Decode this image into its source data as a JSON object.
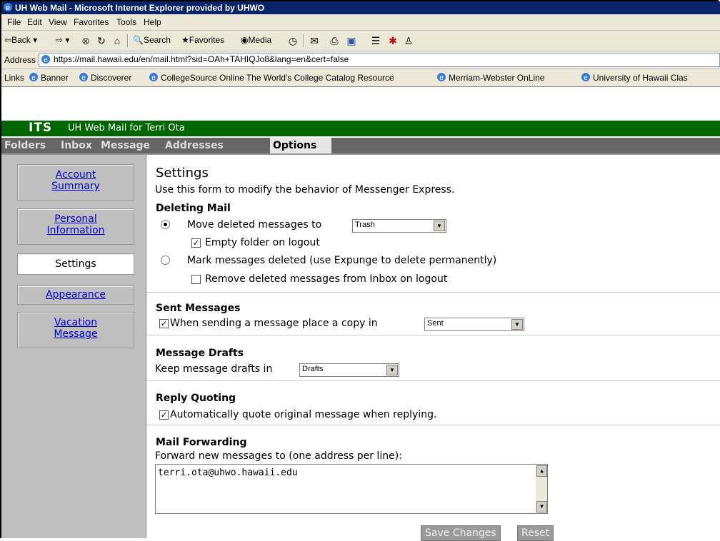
{
  "window": {
    "title": "UH Web Mail - Microsoft Internet Explorer provided by UHWO"
  },
  "menu": [
    "File",
    "Edit",
    "View",
    "Favorites",
    "Tools",
    "Help"
  ],
  "toolbar": {
    "back": "Back",
    "search": "Search",
    "favorites": "Favorites",
    "media": "Media"
  },
  "address": {
    "label": "Address",
    "url": "https://mail.hawaii.edu/en/mail.html?sid=OAh+TAHIQJo8&lang=en&cert=false"
  },
  "links": {
    "label": "Links",
    "items": [
      "Banner",
      "Discoverer",
      "CollegeSource Online  The World's College Catalog Resource",
      "Merriam-Webster OnLine",
      "University of Hawaii Clas"
    ]
  },
  "app": {
    "logo": "ITS",
    "subtitle": "UH Web Mail for Terri Ota"
  },
  "tabs": [
    "Folders",
    "Inbox",
    "Message",
    "Addresses",
    "Options"
  ],
  "sidebar": {
    "account": [
      "Account",
      "Summary"
    ],
    "personal": [
      "Personal",
      "Information"
    ],
    "settings": "Settings",
    "appearance": "Appearance",
    "vacation": [
      "Vacation",
      "Message"
    ]
  },
  "settings": {
    "title": "Settings",
    "intro": "Use this form to modify the behavior of Messenger Express.",
    "deleting": {
      "heading": "Deleting Mail",
      "move_label": "Move deleted messages to",
      "move_folder": "Trash",
      "empty_label": "Empty folder on logout",
      "mark_label": "Mark messages deleted (use Expunge to delete permanently)",
      "remove_label": "Remove deleted messages from Inbox on logout"
    },
    "sent": {
      "heading": "Sent Messages",
      "label": "When sending a message place a copy in",
      "folder": "Sent"
    },
    "drafts": {
      "heading": "Message Drafts",
      "label": "Keep message drafts in",
      "folder": "Drafts"
    },
    "reply": {
      "heading": "Reply Quoting",
      "label": "Automatically quote original message when replying."
    },
    "forwarding": {
      "heading": "Mail Forwarding",
      "label": "Forward new messages to (one address per line):",
      "value": "terri.ota@uhwo.hawaii.edu"
    },
    "buttons": {
      "save": "Save Changes",
      "reset": "Reset"
    }
  },
  "colors": {
    "titlebar": "#0a246a",
    "app_header": "#006600",
    "tabbar": "#666666",
    "sidebar": "#bfbfbf",
    "link": "#0000cc"
  }
}
